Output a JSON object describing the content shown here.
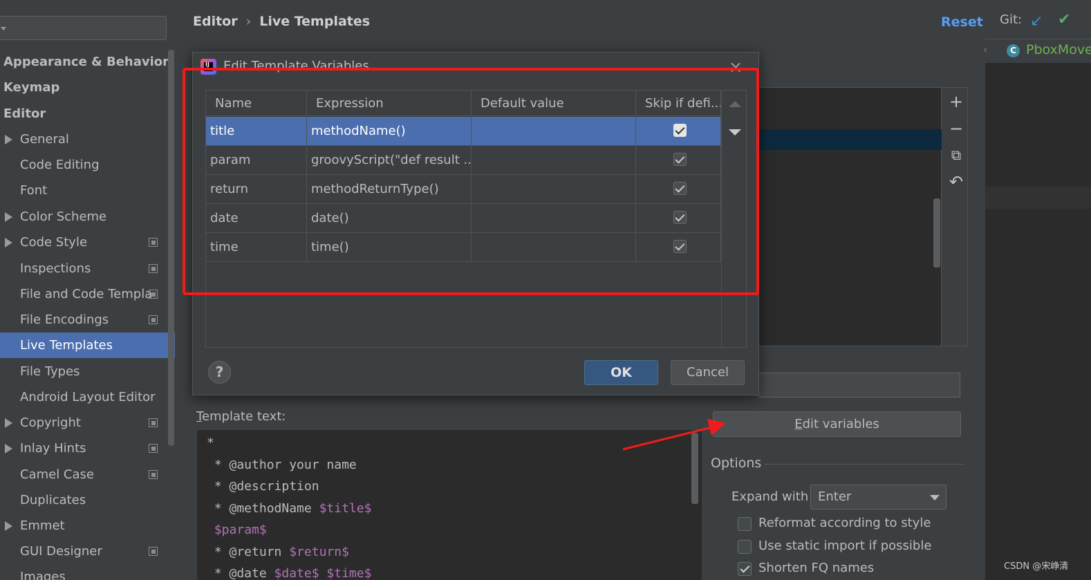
{
  "settings_tree": {
    "items": [
      {
        "label": "Appearance & Behavior",
        "bold": true,
        "arrow": false,
        "copy": false,
        "selected": false
      },
      {
        "label": "Keymap",
        "bold": true,
        "arrow": false,
        "copy": false,
        "selected": false
      },
      {
        "label": "Editor",
        "bold": true,
        "arrow": false,
        "copy": false,
        "selected": false
      },
      {
        "label": "General",
        "bold": false,
        "arrow": true,
        "copy": false,
        "selected": false
      },
      {
        "label": "Code Editing",
        "bold": false,
        "arrow": false,
        "copy": false,
        "selected": false
      },
      {
        "label": "Font",
        "bold": false,
        "arrow": false,
        "copy": false,
        "selected": false
      },
      {
        "label": "Color Scheme",
        "bold": false,
        "arrow": true,
        "copy": false,
        "selected": false
      },
      {
        "label": "Code Style",
        "bold": false,
        "arrow": true,
        "copy": true,
        "selected": false
      },
      {
        "label": "Inspections",
        "bold": false,
        "arrow": false,
        "copy": true,
        "selected": false
      },
      {
        "label": "File and Code Templa",
        "bold": false,
        "arrow": false,
        "copy": true,
        "selected": false
      },
      {
        "label": "File Encodings",
        "bold": false,
        "arrow": false,
        "copy": true,
        "selected": false
      },
      {
        "label": "Live Templates",
        "bold": false,
        "arrow": false,
        "copy": false,
        "selected": true
      },
      {
        "label": "File Types",
        "bold": false,
        "arrow": false,
        "copy": false,
        "selected": false
      },
      {
        "label": "Android Layout Editor",
        "bold": false,
        "arrow": false,
        "copy": false,
        "selected": false
      },
      {
        "label": "Copyright",
        "bold": false,
        "arrow": true,
        "copy": true,
        "selected": false
      },
      {
        "label": "Inlay Hints",
        "bold": false,
        "arrow": true,
        "copy": true,
        "selected": false
      },
      {
        "label": "Camel Case",
        "bold": false,
        "arrow": false,
        "copy": true,
        "selected": false
      },
      {
        "label": "Duplicates",
        "bold": false,
        "arrow": false,
        "copy": false,
        "selected": false
      },
      {
        "label": "Emmet",
        "bold": false,
        "arrow": true,
        "copy": false,
        "selected": false
      },
      {
        "label": "GUI Designer",
        "bold": false,
        "arrow": false,
        "copy": true,
        "selected": false
      },
      {
        "label": "Images",
        "bold": false,
        "arrow": false,
        "copy": false,
        "selected": false
      }
    ]
  },
  "breadcrumb": {
    "root": "Editor",
    "separator": "›",
    "current": "Live Templates"
  },
  "reset_label": "Reset",
  "git": {
    "label": "Git:",
    "update_icon": "arrow-down-left-icon",
    "commit_icon": "check-icon"
  },
  "editor_tab": {
    "letter": "C",
    "name": "PboxMove"
  },
  "dialog": {
    "title": "Edit Template Variables",
    "close_glyph": "×",
    "columns": [
      "Name",
      "Expression",
      "Default value",
      "Skip if defi..."
    ],
    "rows": [
      {
        "name": "title",
        "expression": "methodName()",
        "default": "",
        "skip": true,
        "selected": true
      },
      {
        "name": "param",
        "expression": "groovyScript(\"def result ...",
        "default": "",
        "skip": true,
        "selected": false
      },
      {
        "name": "return",
        "expression": "methodReturnType()",
        "default": "",
        "skip": true,
        "selected": false
      },
      {
        "name": "date",
        "expression": "date()",
        "default": "",
        "skip": true,
        "selected": false
      },
      {
        "name": "time",
        "expression": "time()",
        "default": "",
        "skip": true,
        "selected": false
      }
    ],
    "help_label": "?",
    "ok_label": "OK",
    "cancel_label": "Cancel"
  },
  "tools": {
    "add": "+",
    "remove": "−",
    "copy": "⧉",
    "revert": "↶"
  },
  "template": {
    "label_prefix": "T",
    "label_rest": "emplate text:",
    "lines": [
      [
        {
          "t": "*",
          "v": false
        }
      ],
      [
        {
          "t": " * @author your name",
          "v": false
        }
      ],
      [
        {
          "t": " * @description",
          "v": false
        }
      ],
      [
        {
          "t": " * @methodName ",
          "v": false
        },
        {
          "t": "$title$",
          "v": true
        }
      ],
      [
        {
          "t": " ",
          "v": false
        },
        {
          "t": "$param$",
          "v": true
        }
      ],
      [
        {
          "t": " * @return ",
          "v": false
        },
        {
          "t": "$return$",
          "v": true
        }
      ],
      [
        {
          "t": " * @date ",
          "v": false
        },
        {
          "t": "$date$",
          "v": true
        },
        {
          "t": " ",
          "v": false
        },
        {
          "t": "$time$",
          "v": true
        }
      ]
    ]
  },
  "edit_variables": {
    "prefix": "E",
    "rest": "dit variables"
  },
  "options": {
    "title": "Options",
    "expand_label": "Expand with",
    "expand_value": "Enter",
    "checkboxes": [
      {
        "label": "Reformat according to style",
        "checked": false
      },
      {
        "label": "Use static import if possible",
        "checked": false
      },
      {
        "label": "Shorten FQ names",
        "checked": true
      }
    ]
  },
  "watermark": "CSDN @宋峥清"
}
